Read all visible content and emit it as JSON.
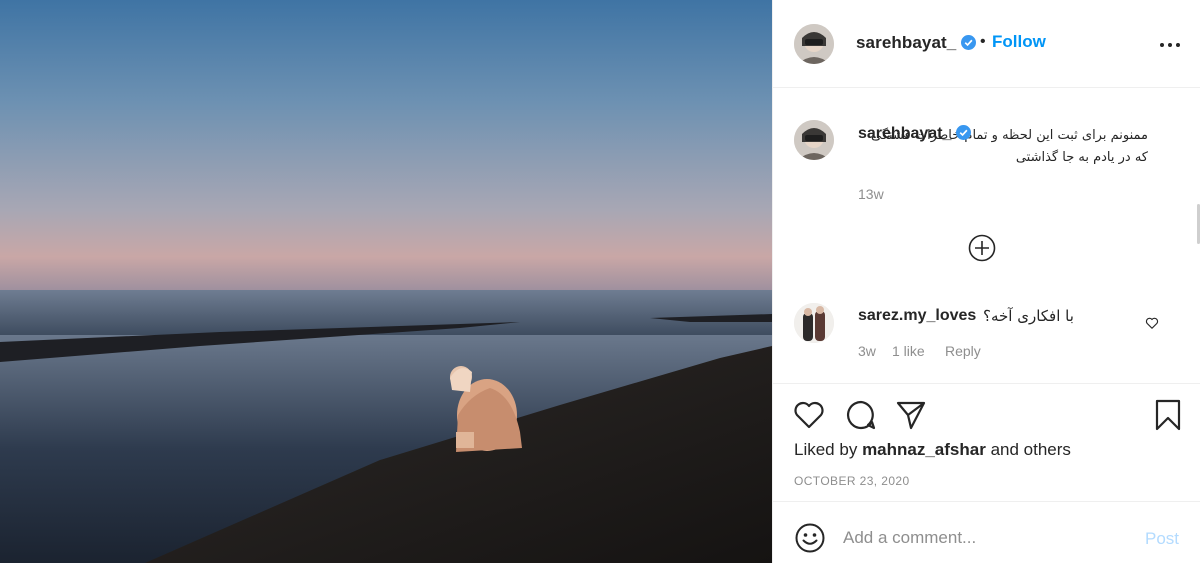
{
  "post": {
    "username": "sarehbayat_",
    "separator": "•",
    "follow_label": "Follow",
    "caption": {
      "username": "sarehbayat_",
      "text": "ممنونم برای ثبت این لحظه و تمام خاطرات قشنگی که در یادم به جا گذاشتی",
      "emoji_glyph": "",
      "time": "13w"
    },
    "comments": [
      {
        "username": "sarez.my_loves",
        "text": "با افکاری آخه؟",
        "time": "3w",
        "likes": "1 like",
        "reply_label": "Reply"
      }
    ],
    "likes_prefix": "Liked by",
    "liked_by": "mahnaz_afshar",
    "likes_suffix": "and others",
    "date": "OCTOBER 23, 2020",
    "add_comment_placeholder": "Add a comment...",
    "post_label": "Post"
  },
  "icons": {
    "verified": "verified-badge-icon",
    "more": "more-options-icon",
    "load_more": "load-more-comments-icon",
    "like": "heart-icon",
    "comment": "comment-icon",
    "share": "share-icon",
    "save": "bookmark-icon",
    "emoji": "emoji-icon"
  },
  "colors": {
    "accent": "#0095f6",
    "post_disabled": "#b3dbff",
    "muted": "#8e8e8e"
  }
}
